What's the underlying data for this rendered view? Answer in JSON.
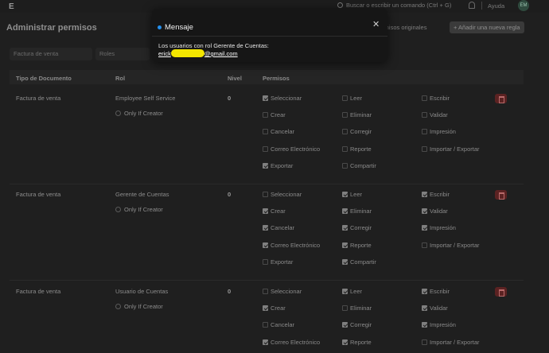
{
  "nav": {
    "logo": "E",
    "search_placeholder": "Buscar o escribir un comando (Ctrl + G)",
    "help": "Ayuda",
    "avatar": "EM"
  },
  "page": {
    "title": "Administrar permisos",
    "restore_btn": "ermisos originales",
    "add_btn": "+ Añadir una nueva regla"
  },
  "filters": {
    "document_type": "Factura de venta",
    "role": "Roles"
  },
  "table": {
    "headers": [
      "Tipo de Documento",
      "Rol",
      "Nivel",
      "Permisos"
    ],
    "only_if_creator": "Only If Creator",
    "perm_labels": [
      [
        "Seleccionar",
        "Leer",
        "Escribir"
      ],
      [
        "Crear",
        "Eliminar",
        "Validar"
      ],
      [
        "Cancelar",
        "Corregir",
        "Impresión"
      ],
      [
        "Correo Electrónico",
        "Reporte",
        "Importar / Exportar"
      ],
      [
        "Exportar",
        "Compartir",
        ""
      ]
    ],
    "rows": [
      {
        "doc": "Factura de venta",
        "role": "Employee Self Service",
        "level": "0",
        "checks": [
          [
            true,
            false,
            false
          ],
          [
            false,
            false,
            false
          ],
          [
            false,
            false,
            false
          ],
          [
            false,
            false,
            false
          ],
          [
            true,
            false,
            null
          ]
        ]
      },
      {
        "doc": "Factura de venta",
        "role": "Gerente de Cuentas",
        "level": "0",
        "checks": [
          [
            false,
            true,
            true
          ],
          [
            true,
            true,
            true
          ],
          [
            true,
            true,
            true
          ],
          [
            true,
            true,
            false
          ],
          [
            false,
            true,
            null
          ]
        ]
      },
      {
        "doc": "Factura de venta",
        "role": "Usuario de Cuentas",
        "level": "0",
        "checks": [
          [
            false,
            true,
            true
          ],
          [
            true,
            false,
            true
          ],
          [
            false,
            true,
            true
          ],
          [
            true,
            true,
            false
          ]
        ]
      }
    ]
  },
  "modal": {
    "title": "Mensaje",
    "body": "Los usuarios con rol Gerente de Cuentas:",
    "email_prefix": "erick",
    "email_suffix": "@gmail.com",
    "accent": "#2490ef"
  }
}
